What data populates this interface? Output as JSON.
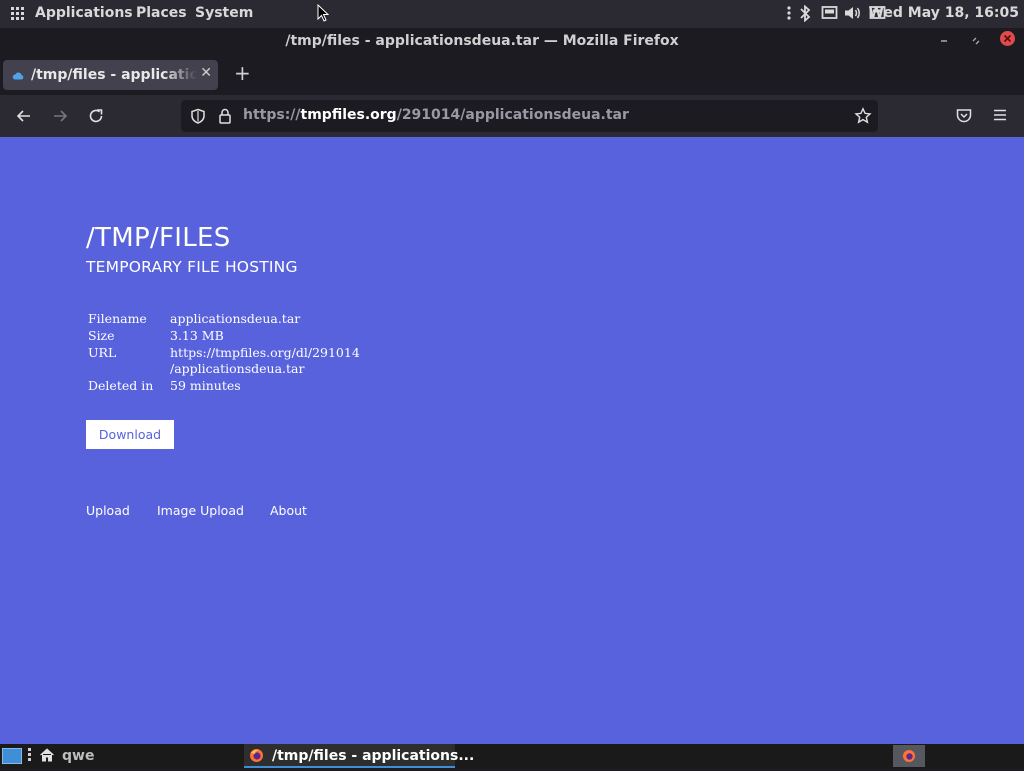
{
  "top_panel": {
    "menus": [
      "Applications",
      "Places",
      "System"
    ],
    "clock": "Wed May 18, 16:05"
  },
  "window": {
    "title": "/tmp/files - applicationsdeua.tar — Mozilla Firefox"
  },
  "tabs": [
    {
      "label": "/tmp/files - applicationsdeua.tar",
      "active": true
    }
  ],
  "urlbar": {
    "url_prefix": "https://",
    "url_host": "tmpfiles.org",
    "url_path": "/291014/applicationsdeua.tar"
  },
  "page": {
    "title": "/TMP/FILES",
    "subtitle": "TEMPORARY FILE HOSTING",
    "info": [
      {
        "key": "Filename",
        "value": "applicationsdeua.tar"
      },
      {
        "key": "Size",
        "value": "3.13 MB"
      },
      {
        "key": "URL",
        "value": "https://tmpfiles.org/dl/291014",
        "value2": "/applicationsdeua.tar"
      },
      {
        "key": "Deleted in",
        "value": "59 minutes"
      }
    ],
    "download_label": "Download",
    "footer_links": [
      "Upload",
      "Image Upload",
      "About"
    ]
  },
  "taskbar": {
    "workspace": "qwe",
    "task_label": "/tmp/files - applications..."
  },
  "colors": {
    "page_bg": "#5762dc",
    "chrome_dark": "#1c1b22",
    "toolbar": "#2b2a33",
    "close_red": "#e24b4b",
    "taskbar_accent": "#3f8fd6"
  }
}
